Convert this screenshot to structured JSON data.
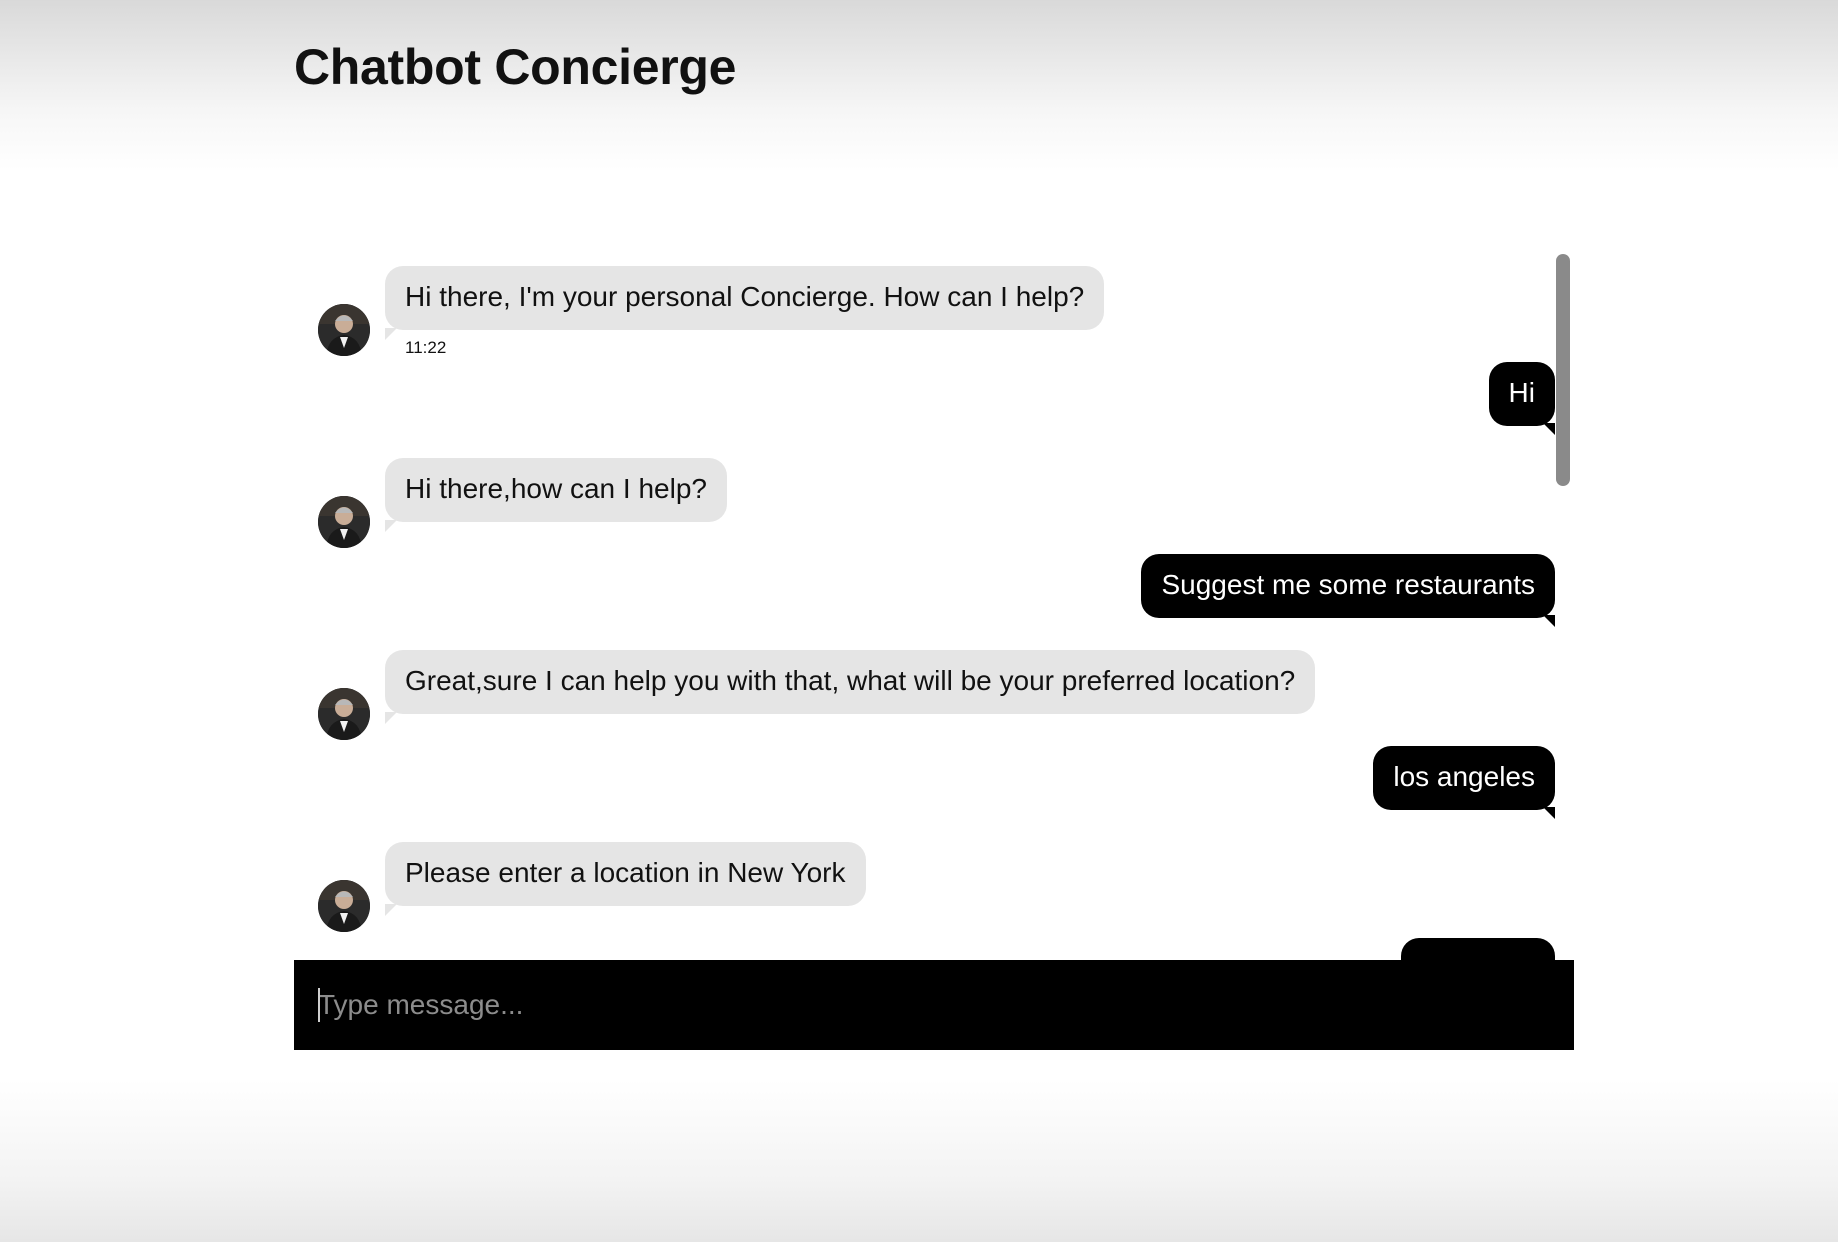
{
  "header": {
    "title": "Chatbot Concierge"
  },
  "conversation": {
    "bot_messages": [
      {
        "text": "Hi there, I'm your personal Concierge. How can I help?",
        "time": "11:22"
      },
      {
        "text": "Hi there,how can I help?"
      },
      {
        "text": "Great,sure I can help you with that, what will be your preferred location?"
      },
      {
        "text": "Please enter a location in New York"
      }
    ],
    "user_messages": [
      {
        "text": "Hi"
      },
      {
        "text": "Suggest me some restaurants"
      },
      {
        "text": "los angeles"
      },
      {
        "text": ""
      }
    ]
  },
  "composer": {
    "placeholder": "Type message..."
  },
  "colors": {
    "bot_bubble": "#e5e5e5",
    "user_bubble": "#000000",
    "input_bar": "#000000"
  }
}
